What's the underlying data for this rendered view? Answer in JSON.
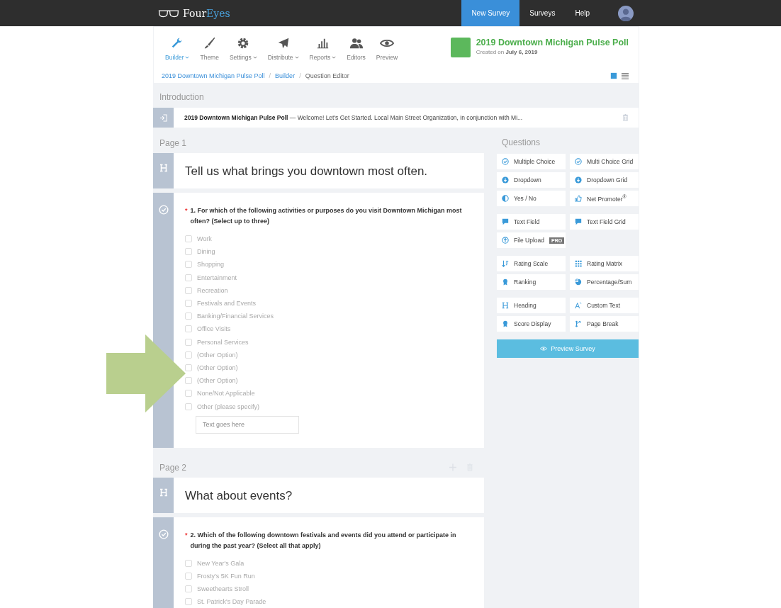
{
  "brand": {
    "name": "Four",
    "accent": "Eyes"
  },
  "nav": [
    {
      "label": "New Survey",
      "selected": true
    },
    {
      "label": "Surveys",
      "selected": false
    },
    {
      "label": "Help",
      "selected": false
    }
  ],
  "toolbar": [
    {
      "label": "Builder",
      "kind": "wrench",
      "dropdown": true,
      "selected": true
    },
    {
      "label": "Theme",
      "kind": "brush",
      "dropdown": false,
      "selected": false
    },
    {
      "label": "Settings",
      "kind": "gear",
      "dropdown": true,
      "selected": false
    },
    {
      "label": "Distribute",
      "kind": "plane",
      "dropdown": true,
      "selected": false
    },
    {
      "label": "Reports",
      "kind": "chart",
      "dropdown": true,
      "selected": false
    },
    {
      "label": "Editors",
      "kind": "people",
      "dropdown": false,
      "selected": false
    },
    {
      "label": "Preview",
      "kind": "eye",
      "dropdown": false,
      "selected": false
    }
  ],
  "survey": {
    "title": "2019 Downtown Michigan Pulse Poll",
    "created": "Created on **July 6, 2019**",
    "color": "#5cb85c"
  },
  "breadcrumb": [
    {
      "label": "2019 Downtown Michigan Pulse Poll",
      "kind": "link"
    },
    {
      "label": "/",
      "kind": "separator"
    },
    {
      "label": "Builder",
      "kind": "link"
    },
    {
      "label": "/",
      "kind": "separator"
    },
    {
      "label": "Question Editor",
      "kind": "current"
    }
  ],
  "views": [
    {
      "kind": "grid",
      "selected": true
    },
    {
      "kind": "list",
      "selected": false
    }
  ],
  "intro": {
    "section": "Introduction",
    "text": "**2019 Downtown Michigan Pulse Poll** — Welcome! Let's Get Started. Local Main Street Organization, in conjunction with Mi..."
  },
  "pages": [
    {
      "label": "Page 1",
      "heading": "Tell us what brings you downtown most often.",
      "question": {
        "required_mark": "*",
        "text": "1.  For which of the following activities or purposes do you visit Downtown Michigan most often? (Select up to three)",
        "placeholder": "Text goes here",
        "options": [
          {
            "label": "Work",
            "checked": false
          },
          {
            "label": "Dining",
            "checked": false
          },
          {
            "label": "Shopping",
            "checked": false
          },
          {
            "label": "Entertainment",
            "checked": false
          },
          {
            "label": "Recreation",
            "checked": false
          },
          {
            "label": "Festivals and Events",
            "checked": false
          },
          {
            "label": "Banking/Financial Services",
            "checked": false
          },
          {
            "label": "Office Visits",
            "checked": false
          },
          {
            "label": "Personal Services",
            "checked": false
          },
          {
            "label": "(Other Option)",
            "checked": false
          },
          {
            "label": "(Other Option)",
            "checked": false
          },
          {
            "label": "(Other Option)",
            "checked": false
          },
          {
            "label": "None/Not Applicable",
            "checked": false
          },
          {
            "label": "Other (please specify)",
            "checked": false
          }
        ]
      }
    },
    {
      "label": "Page 2",
      "actions": [
        {
          "kind": "add"
        },
        {
          "kind": "delete"
        }
      ],
      "heading": "What about events?",
      "question": {
        "required_mark": "*",
        "text": "2.  Which of the following downtown festivals and events did you attend or participate in during the past year?  (Select all that apply)",
        "options": [
          {
            "label": "New Year's Gala",
            "checked": false
          },
          {
            "label": "Frosty's 5K Fun Run",
            "checked": false
          },
          {
            "label": "Sweethearts Stroll",
            "checked": false
          },
          {
            "label": "St. Patrick's Day Parade",
            "checked": false
          }
        ]
      }
    }
  ],
  "questions_panel": {
    "title": "Questions",
    "groups": [
      [
        {
          "label": "Multiple Choice",
          "kind": "check"
        },
        {
          "label": "Multi Choice Grid",
          "kind": "check"
        },
        {
          "label": "Dropdown",
          "kind": "dropdown"
        },
        {
          "label": "Dropdown Grid",
          "kind": "dropdown"
        },
        {
          "label": "Yes / No",
          "kind": "half"
        },
        {
          "label": "Net Promoter$^{®}$",
          "kind": "thumb"
        }
      ],
      [
        {
          "label": "Text Field",
          "kind": "bubble"
        },
        {
          "label": "Text Field Grid",
          "kind": "bubble"
        },
        {
          "label": "File Upload",
          "kind": "upload",
          "badge": "PRO"
        }
      ],
      [
        {
          "label": "Rating Scale",
          "kind": "sort"
        },
        {
          "label": "Rating Matrix",
          "kind": "dots"
        },
        {
          "label": "Ranking",
          "kind": "ribbon"
        },
        {
          "label": "Percentage/Sum",
          "kind": "pie"
        }
      ],
      [
        {
          "label": "Heading",
          "kind": "heading"
        },
        {
          "label": "Custom Text",
          "kind": "font"
        },
        {
          "label": "Score Display",
          "kind": "ribbon"
        },
        {
          "label": "Page Break",
          "kind": "branch"
        }
      ]
    ],
    "preview_button": "Preview Survey"
  }
}
